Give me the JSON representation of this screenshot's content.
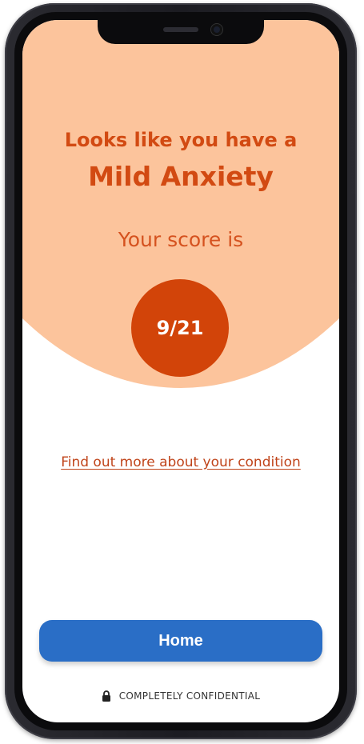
{
  "result": {
    "intro_line": "Looks like you have a",
    "condition": "Mild Anxiety",
    "score_label": "Your score is",
    "score_value": "9/21",
    "score": 9,
    "score_max": 21
  },
  "links": {
    "more_info": "Find out more about your condition"
  },
  "actions": {
    "home_label": "Home"
  },
  "footer": {
    "confidential_text": "COMPLETELY CONFIDENTIAL",
    "icon": "lock-icon"
  },
  "colors": {
    "header_bg": "#fcc49c",
    "accent": "#d24409",
    "headline_text": "#d24a12",
    "button_bg": "#2a6ec6"
  }
}
